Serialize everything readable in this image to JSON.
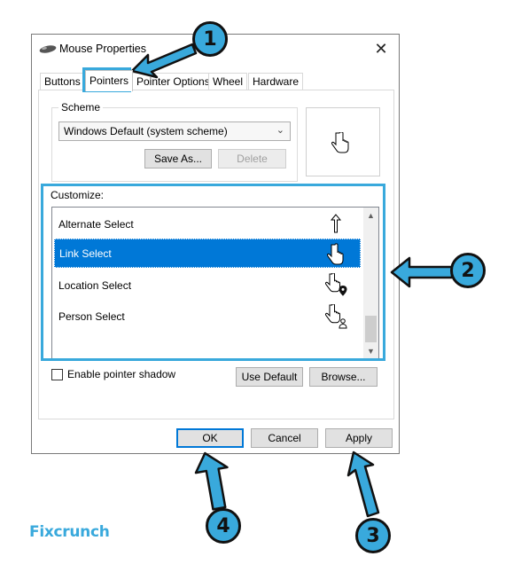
{
  "window": {
    "title": "Mouse Properties",
    "close_glyph": "✕"
  },
  "tabs": [
    {
      "label": "Buttons",
      "active": false
    },
    {
      "label": "Pointers",
      "active": true
    },
    {
      "label": "Pointer Options",
      "active": false
    },
    {
      "label": "Wheel",
      "active": false
    },
    {
      "label": "Hardware",
      "active": false
    }
  ],
  "scheme": {
    "group_label": "Scheme",
    "selected": "Windows Default (system scheme)",
    "save_as_label": "Save As...",
    "delete_label": "Delete"
  },
  "customize": {
    "label": "Customize:",
    "items": [
      {
        "label": "Alternate Select",
        "icon": "up-arrow-cursor-icon",
        "selected": false
      },
      {
        "label": "Link Select",
        "icon": "hand-cursor-icon",
        "selected": true
      },
      {
        "label": "Location Select",
        "icon": "hand-location-cursor-icon",
        "selected": false
      },
      {
        "label": "Person Select",
        "icon": "hand-person-cursor-icon",
        "selected": false
      }
    ]
  },
  "options": {
    "shadow_label": "Enable pointer shadow",
    "shadow_checked": false,
    "use_default_label": "Use Default",
    "browse_label": "Browse..."
  },
  "footer": {
    "ok_label": "OK",
    "cancel_label": "Cancel",
    "apply_label": "Apply"
  },
  "callouts": {
    "one": "1",
    "two": "2",
    "three": "3",
    "four": "4",
    "color": "#39a9dc"
  },
  "brand": {
    "logo": "Fixcrunch"
  },
  "colors": {
    "selection": "#0078d7",
    "accent": "#39a9dc"
  }
}
